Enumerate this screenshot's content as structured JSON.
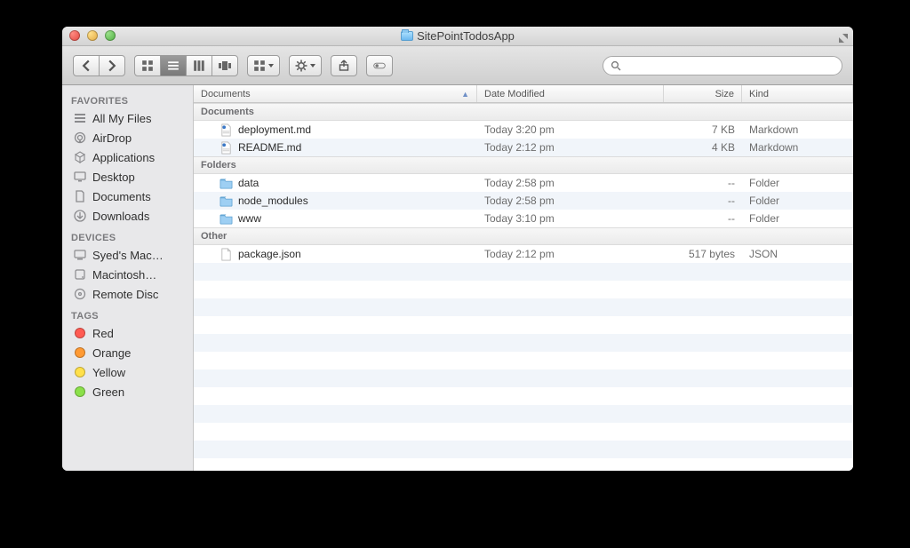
{
  "window": {
    "title": "SitePointTodosApp"
  },
  "columns": {
    "name": "Documents",
    "date": "Date Modified",
    "size": "Size",
    "kind": "Kind"
  },
  "search": {
    "placeholder": ""
  },
  "sidebar": {
    "sections": [
      {
        "heading": "FAVORITES",
        "items": [
          {
            "label": "All My Files",
            "icon": "all-my-files-icon"
          },
          {
            "label": "AirDrop",
            "icon": "airdrop-icon"
          },
          {
            "label": "Applications",
            "icon": "applications-icon"
          },
          {
            "label": "Desktop",
            "icon": "desktop-icon"
          },
          {
            "label": "Documents",
            "icon": "documents-icon"
          },
          {
            "label": "Downloads",
            "icon": "downloads-icon"
          }
        ]
      },
      {
        "heading": "DEVICES",
        "items": [
          {
            "label": "Syed's Mac…",
            "icon": "computer-icon"
          },
          {
            "label": "Macintosh…",
            "icon": "disk-icon"
          },
          {
            "label": "Remote Disc",
            "icon": "optical-disc-icon"
          }
        ]
      },
      {
        "heading": "TAGS",
        "items": [
          {
            "label": "Red",
            "icon": "tag-dot",
            "color": "#ff5b52"
          },
          {
            "label": "Orange",
            "icon": "tag-dot",
            "color": "#ff9a33"
          },
          {
            "label": "Yellow",
            "icon": "tag-dot",
            "color": "#ffe04a"
          },
          {
            "label": "Green",
            "icon": "tag-dot",
            "color": "#8be04a"
          }
        ]
      }
    ]
  },
  "groups": [
    {
      "title": "Documents",
      "rows": [
        {
          "name": "deployment.md",
          "date": "Today 3:20 pm",
          "size": "7 KB",
          "kind": "Markdown",
          "icon": "markdown-file-icon"
        },
        {
          "name": "README.md",
          "date": "Today 2:12 pm",
          "size": "4 KB",
          "kind": "Markdown",
          "icon": "markdown-file-icon"
        }
      ]
    },
    {
      "title": "Folders",
      "rows": [
        {
          "name": "data",
          "date": "Today 2:58 pm",
          "size": "--",
          "kind": "Folder",
          "icon": "folder-icon"
        },
        {
          "name": "node_modules",
          "date": "Today 2:58 pm",
          "size": "--",
          "kind": "Folder",
          "icon": "folder-icon"
        },
        {
          "name": "www",
          "date": "Today 3:10 pm",
          "size": "--",
          "kind": "Folder",
          "icon": "folder-icon"
        }
      ]
    },
    {
      "title": "Other",
      "rows": [
        {
          "name": "package.json",
          "date": "Today 2:12 pm",
          "size": "517 bytes",
          "kind": "JSON",
          "icon": "generic-file-icon"
        }
      ]
    }
  ]
}
